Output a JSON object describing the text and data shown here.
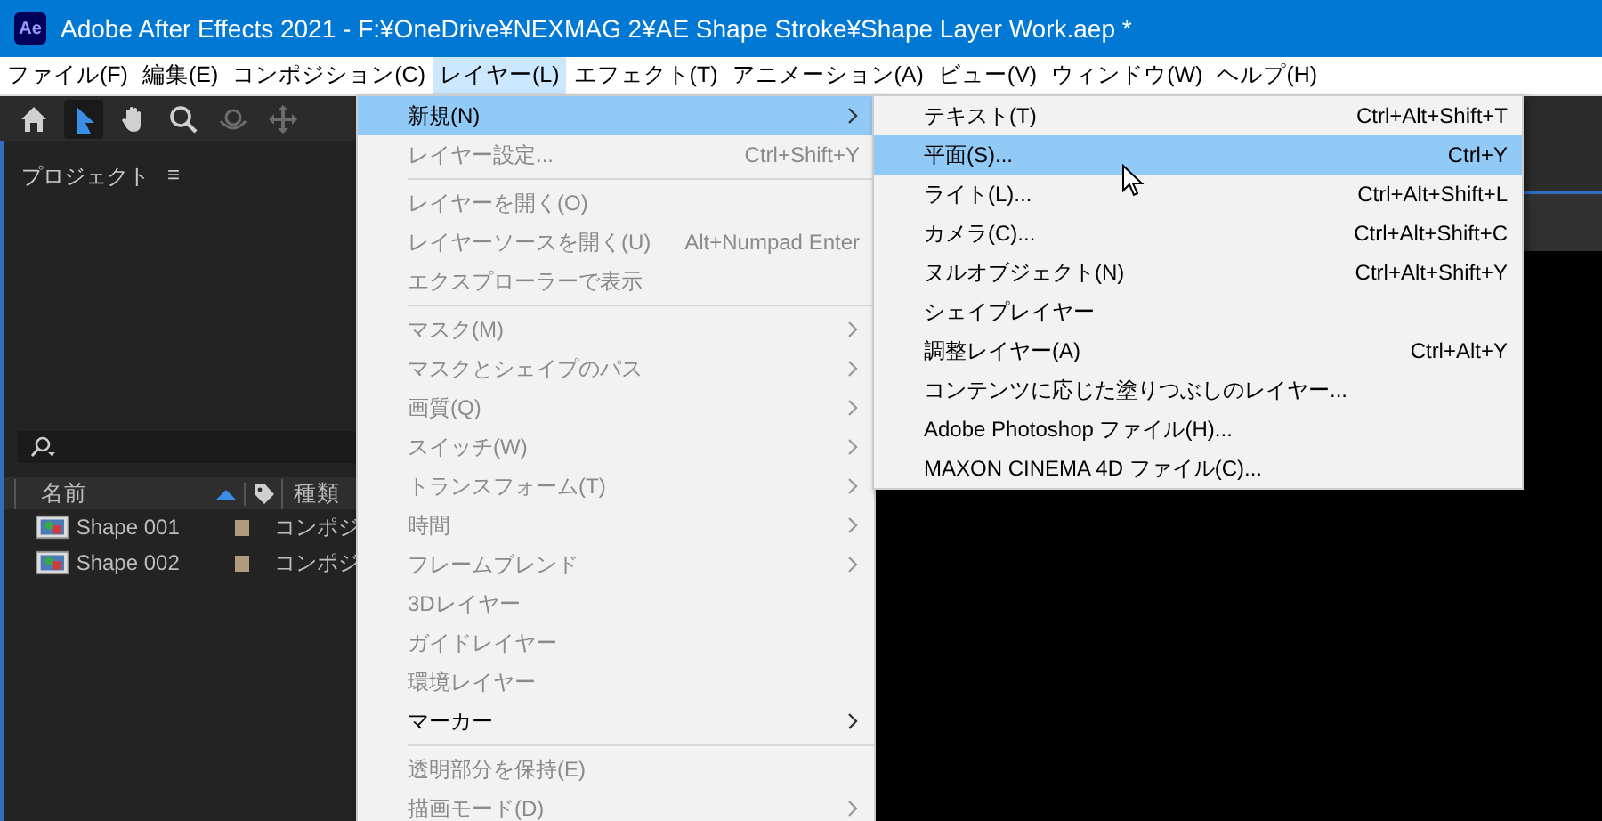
{
  "window": {
    "app_icon_text": "Ae",
    "title": "Adobe After Effects 2021 - F:¥OneDrive¥NEXMAG 2¥AE Shape Stroke¥Shape Layer Work.aep *"
  },
  "menubar": [
    {
      "label": "ファイル(F)",
      "selected": false
    },
    {
      "label": "編集(E)",
      "selected": false
    },
    {
      "label": "コンポジション(C)",
      "selected": false
    },
    {
      "label": "レイヤー(L)",
      "selected": true
    },
    {
      "label": "エフェクト(T)",
      "selected": false
    },
    {
      "label": "アニメーション(A)",
      "selected": false
    },
    {
      "label": "ビュー(V)",
      "selected": false
    },
    {
      "label": "ウィンドウ(W)",
      "selected": false
    },
    {
      "label": "ヘルプ(H)",
      "selected": false
    }
  ],
  "toolbar": [
    {
      "kind": "home",
      "selected": false,
      "disabled": false
    },
    {
      "kind": "selection",
      "selected": true,
      "disabled": false
    },
    {
      "kind": "hand",
      "selected": false,
      "disabled": false
    },
    {
      "kind": "zoom",
      "selected": false,
      "disabled": false
    },
    {
      "kind": "orbit",
      "selected": false,
      "disabled": true
    },
    {
      "kind": "move",
      "selected": false,
      "disabled": true
    }
  ],
  "project_panel": {
    "title": "プロジェクト",
    "menu_glyph": "≡",
    "columns": [
      {
        "kind": "name",
        "label": "名前",
        "sorted": true
      },
      {
        "kind": "label"
      },
      {
        "kind": "type",
        "label": "種類"
      }
    ],
    "rows": [
      {
        "name": "Shape 001",
        "color": "#b09b7c",
        "type": "コンポジ"
      },
      {
        "name": "Shape 002",
        "color": "#b09b7c",
        "type": "コンポジ"
      }
    ]
  },
  "layer_menu": [
    {
      "kind": "item",
      "label": "新規(N)",
      "disabled": false,
      "selected": true,
      "submenu": true
    },
    {
      "kind": "item",
      "label": "レイヤー設定...",
      "shortcut": "Ctrl+Shift+Y",
      "disabled": true,
      "selected": false,
      "submenu": false
    },
    {
      "kind": "separator"
    },
    {
      "kind": "item",
      "label": "レイヤーを開く(O)",
      "disabled": true,
      "selected": false,
      "submenu": false
    },
    {
      "kind": "item",
      "label": "レイヤーソースを開く(U)",
      "shortcut": "Alt+Numpad Enter",
      "disabled": true,
      "selected": false,
      "submenu": false
    },
    {
      "kind": "item",
      "label": "エクスプローラーで表示",
      "disabled": true,
      "selected": false,
      "submenu": false
    },
    {
      "kind": "separator"
    },
    {
      "kind": "item",
      "label": "マスク(M)",
      "disabled": true,
      "selected": false,
      "submenu": true
    },
    {
      "kind": "item",
      "label": "マスクとシェイプのパス",
      "disabled": true,
      "selected": false,
      "submenu": true
    },
    {
      "kind": "item",
      "label": "画質(Q)",
      "disabled": true,
      "selected": false,
      "submenu": true
    },
    {
      "kind": "item",
      "label": "スイッチ(W)",
      "disabled": true,
      "selected": false,
      "submenu": true
    },
    {
      "kind": "item",
      "label": "トランスフォーム(T)",
      "disabled": true,
      "selected": false,
      "submenu": true
    },
    {
      "kind": "item",
      "label": "時間",
      "disabled": true,
      "selected": false,
      "submenu": true
    },
    {
      "kind": "item",
      "label": "フレームブレンド",
      "disabled": true,
      "selected": false,
      "submenu": true
    },
    {
      "kind": "item",
      "label": "3Dレイヤー",
      "disabled": true,
      "selected": false,
      "submenu": false
    },
    {
      "kind": "item",
      "label": "ガイドレイヤー",
      "disabled": true,
      "selected": false,
      "submenu": false
    },
    {
      "kind": "item",
      "label": "環境レイヤー",
      "disabled": true,
      "selected": false,
      "submenu": false
    },
    {
      "kind": "item",
      "label": "マーカー",
      "disabled": false,
      "selected": false,
      "submenu": true
    },
    {
      "kind": "separator"
    },
    {
      "kind": "item",
      "label": "透明部分を保持(E)",
      "disabled": true,
      "selected": false,
      "submenu": false
    },
    {
      "kind": "item",
      "label": "描画モード(D)",
      "disabled": true,
      "selected": false,
      "submenu": true
    }
  ],
  "new_submenu": [
    {
      "kind": "item",
      "label": "テキスト(T)",
      "shortcut": "Ctrl+Alt+Shift+T",
      "disabled": false,
      "selected": false,
      "submenu": false
    },
    {
      "kind": "item",
      "label": "平面(S)...",
      "shortcut": "Ctrl+Y",
      "disabled": false,
      "selected": true,
      "submenu": false
    },
    {
      "kind": "item",
      "label": "ライト(L)...",
      "shortcut": "Ctrl+Alt+Shift+L",
      "disabled": false,
      "selected": false,
      "submenu": false
    },
    {
      "kind": "item",
      "label": "カメラ(C)...",
      "shortcut": "Ctrl+Alt+Shift+C",
      "disabled": false,
      "selected": false,
      "submenu": false
    },
    {
      "kind": "item",
      "label": "ヌルオブジェクト(N)",
      "shortcut": "Ctrl+Alt+Shift+Y",
      "disabled": false,
      "selected": false,
      "submenu": false
    },
    {
      "kind": "item",
      "label": "シェイプレイヤー",
      "disabled": false,
      "selected": false,
      "submenu": false
    },
    {
      "kind": "item",
      "label": "調整レイヤー(A)",
      "shortcut": "Ctrl+Alt+Y",
      "disabled": false,
      "selected": false,
      "submenu": false
    },
    {
      "kind": "item",
      "label": "コンテンツに応じた塗りつぶしのレイヤー...",
      "disabled": false,
      "selected": false,
      "submenu": false
    },
    {
      "kind": "item",
      "label": "Adobe Photoshop ファイル(H)...",
      "disabled": false,
      "selected": false,
      "submenu": false
    },
    {
      "kind": "item",
      "label": "MAXON CINEMA 4D ファイル(C)...",
      "disabled": false,
      "selected": false,
      "submenu": false
    }
  ]
}
